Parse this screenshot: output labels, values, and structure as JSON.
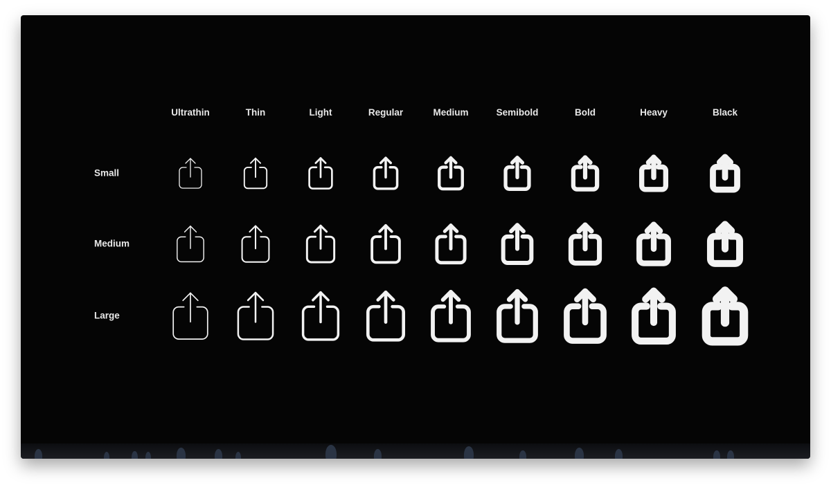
{
  "weights": [
    "Ultrathin",
    "Thin",
    "Light",
    "Regular",
    "Medium",
    "Semibold",
    "Bold",
    "Heavy",
    "Black"
  ],
  "scales": [
    "Small",
    "Medium",
    "Large"
  ],
  "icon": "square-and-arrow-up-icon",
  "colors": {
    "background": "#050505",
    "foreground": "#f2f2f2"
  }
}
